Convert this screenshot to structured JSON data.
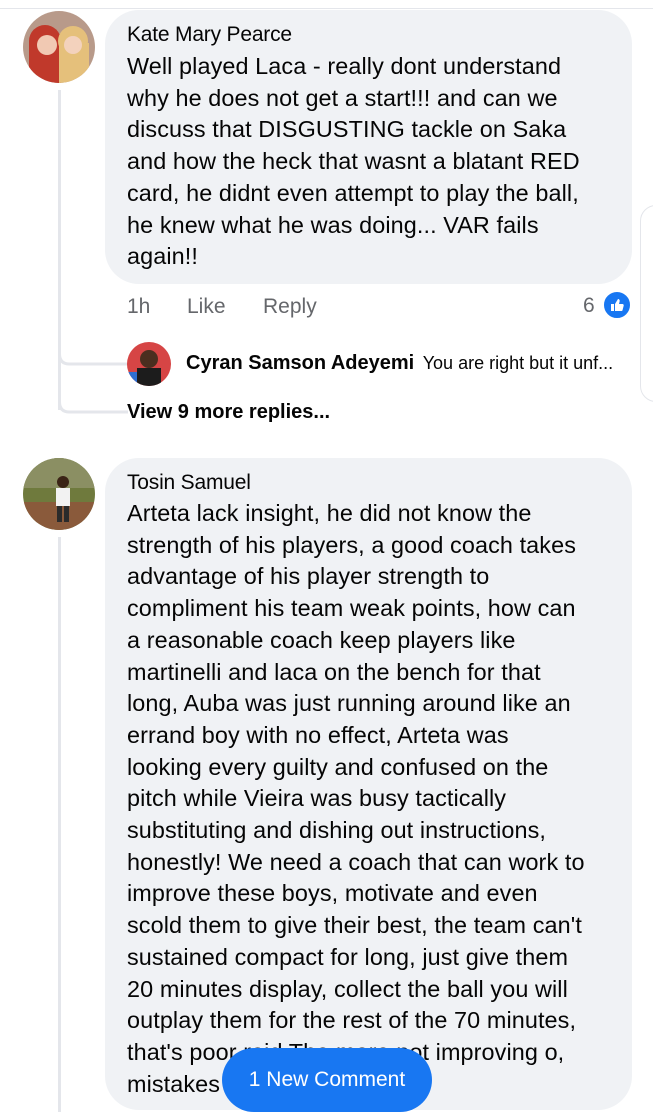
{
  "comments": [
    {
      "author": "Kate Mary Pearce",
      "text": "Well played Laca - really dont understand\nwhy he does not get a start!!! and can we\ndiscuss that DISGUSTING tackle on Saka\nand how the heck that wasnt a blatant RED\ncard, he didnt even attempt to play the ball,\nhe knew what he was doing... VAR fails\nagain!!",
      "time": "1h",
      "like_label": "Like",
      "reply_label": "Reply",
      "reaction_count": "6",
      "reply_preview": {
        "author": "Cyran Samson Adeyemi",
        "text": "You are right but it unf..."
      },
      "view_more": "View 9 more replies..."
    },
    {
      "author": "Tosin Samuel",
      "text": "Arteta lack insight, he did not know the\nstrength of his players, a good coach takes\nadvantage of his player strength to\ncompliment his team weak points, how can\na reasonable coach keep players like\nmartinelli and laca on the bench for that\nlong, Auba was just running around like an\nerrand boy with no effect, Arteta was\nlooking every guilty and confused on the\npitch while Vieira was busy tactically\nsubstituting and dishing out instructions,\nhonestly! We need a coach that can work to\nimprove these boys, motivate and even\nscold them to give their best, the team can't\nsustained compact for long, just give them\n20 minutes display, collect the ball you will\noutplay them for the rest of the 70 minutes,\nthat's poor raid The more not improving o,\nmistakes"
    }
  ],
  "new_comment_button": "1 New Comment",
  "icons": {
    "like": "thumbs-up-icon"
  },
  "colors": {
    "accent": "#1877f2",
    "bubble": "#f0f2f5",
    "secondary_text": "#65676b"
  }
}
